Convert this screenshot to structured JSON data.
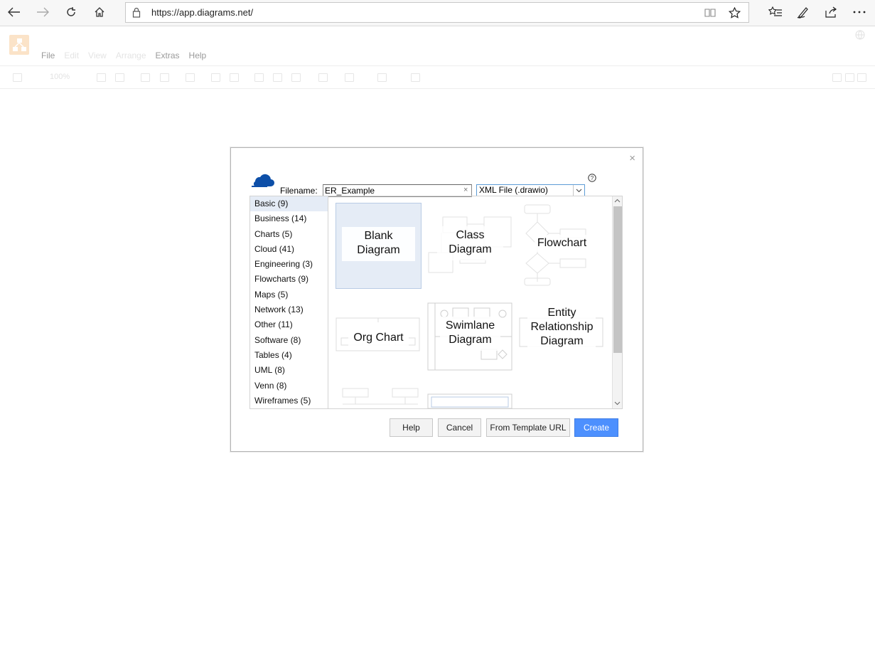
{
  "browser": {
    "url": "https://app.diagrams.net/"
  },
  "app": {
    "menu": [
      "File",
      "Edit",
      "View",
      "Arrange",
      "Extras",
      "Help"
    ],
    "zoom": "100%"
  },
  "dialog": {
    "close_label": "×",
    "filename_label": "Filename:",
    "filename_value": "ER_Example",
    "clear_label": "×",
    "format_value": "XML File (.drawio)",
    "help_label": "?",
    "categories": [
      "Basic (9)",
      "Business (14)",
      "Charts (5)",
      "Cloud (41)",
      "Engineering (3)",
      "Flowcharts (9)",
      "Maps (5)",
      "Network (13)",
      "Other (11)",
      "Software (8)",
      "Tables (4)",
      "UML (8)",
      "Venn (8)",
      "Wireframes (5)"
    ],
    "selected_category": "Basic (9)",
    "templates": {
      "blank": "Blank\nDiagram",
      "class": "Class\nDiagram",
      "flowchart": "Flowchart",
      "org": "Org Chart",
      "swimlane": "Swimlane\nDiagram",
      "er": "Entity\nRelationship\nDiagram"
    },
    "buttons": {
      "help": "Help",
      "cancel": "Cancel",
      "template_url": "From Template URL",
      "create": "Create"
    }
  },
  "colors": {
    "accent": "#4d90fe",
    "selected_bg": "#e5ecf6",
    "cloud_icon": "#0d4fa8"
  }
}
